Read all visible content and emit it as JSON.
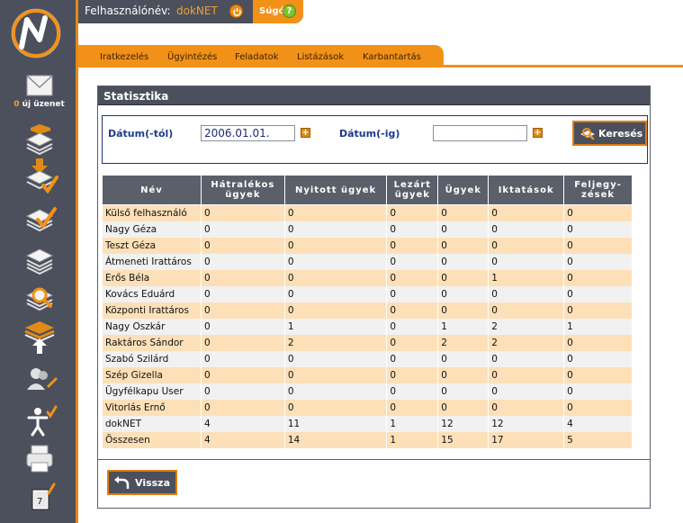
{
  "user": {
    "label": "Felhasználónév:",
    "name": "dokNET"
  },
  "help": {
    "label": "Súgó",
    "icon": "question-icon"
  },
  "messages": {
    "count": "0",
    "text": "új üzenet"
  },
  "menu": [
    "Iratkezelés",
    "Ügyintézés",
    "Feladatok",
    "Listázások",
    "Karbantartás"
  ],
  "panel": {
    "title": "Statisztika"
  },
  "filter": {
    "from_label": "Dátum(-tól)",
    "from_value": "2006.01.01.",
    "to_label": "Dátum(-ig)",
    "to_value": "",
    "search_label": "Keresés"
  },
  "table": {
    "headers": [
      "Név",
      "Hátralékos ügyek",
      "Nyitott ügyek",
      "Lezárt ügyek",
      "Ügyek",
      "Iktatások",
      "Feljegy-zések"
    ],
    "rows": [
      [
        "Külső felhasználó",
        "0",
        "0",
        "0",
        "0",
        "0",
        "0"
      ],
      [
        "Nagy Géza",
        "0",
        "0",
        "0",
        "0",
        "0",
        "0"
      ],
      [
        "Teszt Géza",
        "0",
        "0",
        "0",
        "0",
        "0",
        "0"
      ],
      [
        "Átmeneti Irattáros",
        "0",
        "0",
        "0",
        "0",
        "0",
        "0"
      ],
      [
        "Erős Béla",
        "0",
        "0",
        "0",
        "0",
        "1",
        "0"
      ],
      [
        "Kovács Eduárd",
        "0",
        "0",
        "0",
        "0",
        "0",
        "0"
      ],
      [
        "Központi Irattáros",
        "0",
        "0",
        "0",
        "0",
        "0",
        "0"
      ],
      [
        "Nagy Oszkár",
        "0",
        "1",
        "0",
        "1",
        "2",
        "1"
      ],
      [
        "Raktáros Sándor",
        "0",
        "2",
        "0",
        "2",
        "2",
        "0"
      ],
      [
        "Szabó Szilárd",
        "0",
        "0",
        "0",
        "0",
        "0",
        "0"
      ],
      [
        "Szép Gizella",
        "0",
        "0",
        "0",
        "0",
        "0",
        "0"
      ],
      [
        "Ügyfélkapu User",
        "0",
        "0",
        "0",
        "0",
        "0",
        "0"
      ],
      [
        "Vitorlás Ernő",
        "0",
        "0",
        "0",
        "0",
        "0",
        "0"
      ],
      [
        "dokNET",
        "4",
        "11",
        "1",
        "12",
        "12",
        "4"
      ],
      [
        "Összesen",
        "4",
        "14",
        "1",
        "15",
        "17",
        "5"
      ]
    ]
  },
  "back_label": "Vissza",
  "colors": {
    "accent": "#f29118",
    "sidebar": "#4b505c",
    "row_odd": "#fde0b8",
    "row_even": "#f1f1f1",
    "label_blue": "#1e3a8a"
  }
}
